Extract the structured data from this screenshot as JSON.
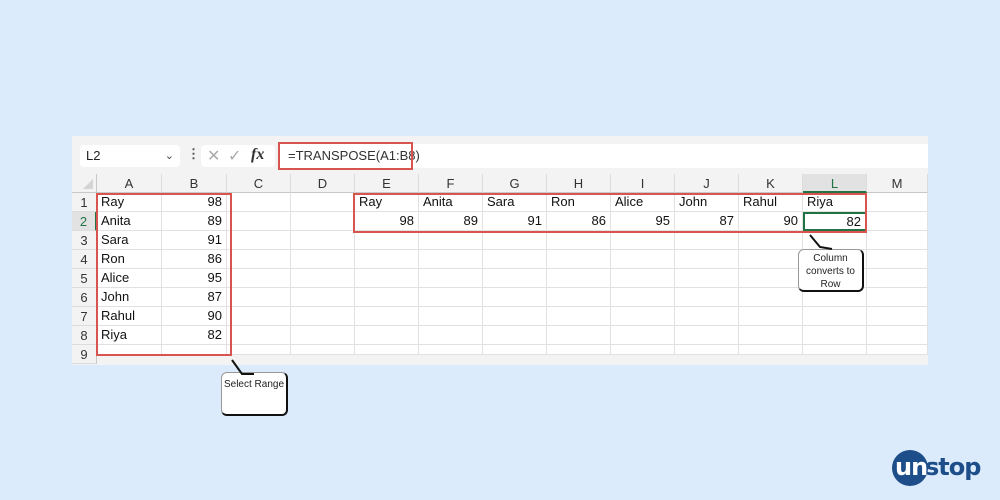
{
  "formula_bar": {
    "name_box": "L2",
    "name_box_dropdown_icon": "chevron-down-icon",
    "more_icon": "vertical-ellipsis-icon",
    "cancel_icon": "✕",
    "enter_icon": "✓",
    "fx_icon": "fx",
    "formula": "=TRANSPOSE(A1:B8)"
  },
  "columns": [
    "A",
    "B",
    "C",
    "D",
    "E",
    "F",
    "G",
    "H",
    "I",
    "J",
    "K",
    "L",
    "M"
  ],
  "rows": [
    "1",
    "2",
    "3",
    "4",
    "5",
    "6",
    "7",
    "8",
    "9"
  ],
  "selected_cell": "L2",
  "source_range": {
    "names": [
      "Ray",
      "Anita",
      "Sara",
      "Ron",
      "Alice",
      "John",
      "Rahul",
      "Riya"
    ],
    "scores": [
      "98",
      "89",
      "91",
      "86",
      "95",
      "87",
      "90",
      "82"
    ]
  },
  "transposed": {
    "names": [
      "Ray",
      "Anita",
      "Sara",
      "Ron",
      "Alice",
      "John",
      "Rahul",
      "Riya"
    ],
    "scores": [
      "98",
      "89",
      "91",
      "86",
      "95",
      "87",
      "90",
      "82"
    ]
  },
  "callouts": {
    "select_range": "Select Range",
    "column_to_row": "Column converts to Row"
  },
  "brand": {
    "logo_part1": "un",
    "logo_part2": "stop",
    "color": "#1d4e89"
  },
  "colors": {
    "highlight": "#d9534f",
    "selection": "#217346",
    "background": "#dcebfc"
  }
}
